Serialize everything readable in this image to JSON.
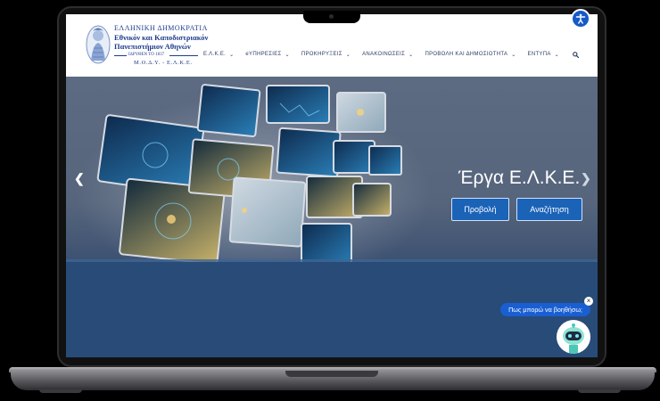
{
  "logo": {
    "line1": "ΕΛΛΗΝΙΚΗ ΔΗΜΟΚΡΑΤΙΑ",
    "line2": "Εθνικόν και Καποδιστριακόν",
    "line3": "Πανεπιστήμιον Αθηνών",
    "line4": "ΙΔΡΥΘΕΝ ΤΟ 1837",
    "line5": "Μ.Ο.Δ.Υ. - Ε.Λ.Κ.Ε."
  },
  "nav": {
    "items": [
      {
        "label": "Ε.Λ.Κ.Ε."
      },
      {
        "label": "eΥΠΗΡΕΣΙΕΣ"
      },
      {
        "label": "ΠΡΟΚΗΡΥΞΕΙΣ"
      },
      {
        "label": "ΑΝΑΚΟΙΝΩΣΕΙΣ"
      },
      {
        "label": "ΠΡΟΒΟΛΗ ΚΑΙ ΔΗΜΟΣΙΟΤΗΤΑ"
      },
      {
        "label": "ΕΝΤΥΠΑ"
      }
    ]
  },
  "hero": {
    "title": "Έργα Ε.Λ.Κ.Ε.",
    "btn_view": "Προβολή",
    "btn_search": "Αναζήτηση",
    "prev_arrow": "❮",
    "next_arrow": "❯"
  },
  "chat": {
    "prompt": "Πως μπορώ να βοηθήσω;",
    "close": "×"
  },
  "colors": {
    "accent": "#1b63b7",
    "nav_text": "#2c3e66",
    "logo_blue": "#1e3c8c"
  }
}
